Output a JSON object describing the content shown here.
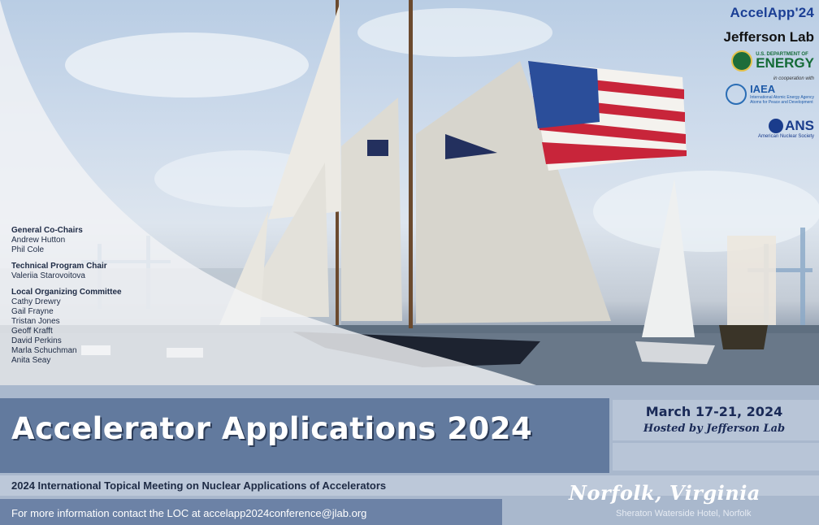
{
  "committee": {
    "cochairs_heading": "General Co-Chairs",
    "cochairs": [
      "Andrew Hutton",
      "Phil Cole"
    ],
    "tpc_heading": "Technical Program Chair",
    "tpc": [
      "Valeriia Starovoitova"
    ],
    "loc_heading": "Local Organizing Committee",
    "loc": [
      "Cathy Drewry",
      "Gail Frayne",
      "Tristan Jones",
      "Geoff Krafft",
      "David Perkins",
      "Marla Schuchman",
      "Anita Seay"
    ]
  },
  "logos": {
    "accelapp": "AccelApp'24",
    "jlab": "Jefferson Lab",
    "doe_small": "U.S. DEPARTMENT OF",
    "doe_big": "ENERGY",
    "coop": "in cooperation with",
    "iaea": "IAEA",
    "iaea_sub1": "International Atomic Energy Agency",
    "iaea_sub2": "Atoms for Peace and Development",
    "ans": "ANS",
    "ans_sub": "American Nuclear Society"
  },
  "title": "Accelerator Applications 2024",
  "date": "March 17-21, 2024",
  "host": "Hosted by Jefferson Lab",
  "subtitle": "2024 International Topical Meeting on Nuclear Applications of Accelerators",
  "info": "For more information contact the LOC at accelapp2024conference@jlab.org",
  "place": "Norfolk, Virginia",
  "hotel": "Sheraton Waterside Hotel, Norfolk",
  "colors": {
    "navy": "#1a2a57",
    "title_bar": "#627a9e",
    "info_bar": "#6c82a6",
    "flag_red": "#c8253a"
  }
}
